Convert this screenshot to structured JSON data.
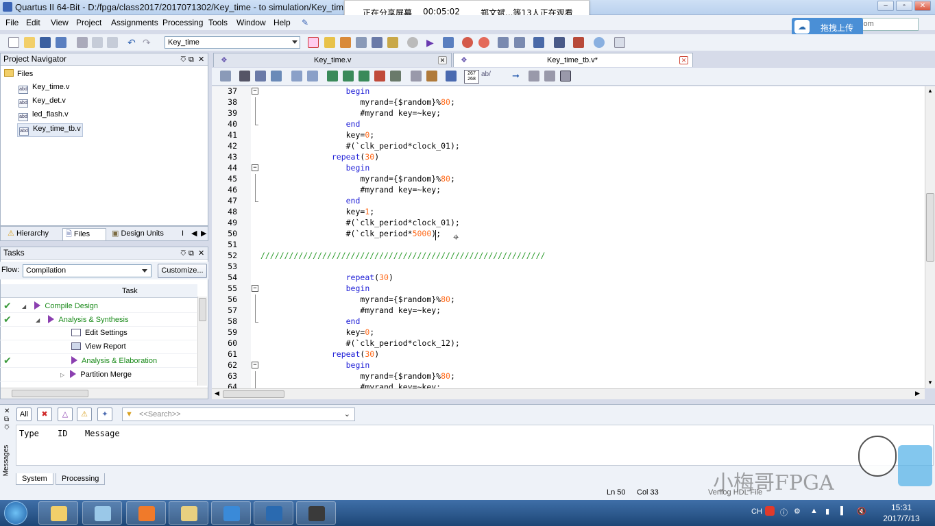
{
  "window": {
    "title": "Quartus II 64-Bit - D:/fpga/class2017/2017071302/Key_time - to simulation/Key_tim",
    "controls": {
      "minimize": "–",
      "restore": "▫",
      "close": "✕"
    }
  },
  "share_banner": {
    "status": "正在分享屏幕",
    "elapsed": "00:05:02",
    "viewers": "郑文斌...等13人正在观看"
  },
  "menu": {
    "items": [
      "File",
      "Edit",
      "View",
      "Project",
      "Assignments",
      "Processing",
      "Tools",
      "Window",
      "Help"
    ]
  },
  "upload_badge": {
    "label": "拖拽上传"
  },
  "top_search": {
    "value": "era.com"
  },
  "toolbar": {
    "entity": "Key_time"
  },
  "project_navigator": {
    "title": "Project Navigator",
    "root": "Files",
    "files": [
      "Key_time.v",
      "Key_det.v",
      "led_flash.v",
      "Key_time_tb.v"
    ],
    "selected": "Key_time_tb.v",
    "tabs": [
      "Hierarchy",
      "Files",
      "Design Units",
      "I"
    ],
    "active_tab": "Files"
  },
  "tasks": {
    "title": "Tasks",
    "flow_label": "Flow:",
    "flow_value": "Compilation",
    "customize_label": "Customize...",
    "column_header": "Task",
    "rows": [
      {
        "label": "Compile Design",
        "done": true,
        "indent": 1,
        "color": "green"
      },
      {
        "label": "Analysis & Synthesis",
        "done": true,
        "indent": 2,
        "color": "green"
      },
      {
        "label": "Edit Settings",
        "done": false,
        "indent": 3,
        "color": "black"
      },
      {
        "label": "View Report",
        "done": false,
        "indent": 3,
        "color": "black"
      },
      {
        "label": "Analysis & Elaboration",
        "done": true,
        "indent": 3,
        "color": "green"
      },
      {
        "label": "Partition Merge",
        "done": false,
        "indent": 3,
        "color": "black"
      }
    ]
  },
  "documents": {
    "tabs": [
      {
        "label": "Key_time.v",
        "active": false
      },
      {
        "label": "Key_time_tb.v*",
        "active": true
      }
    ]
  },
  "editor": {
    "zoom_badge": "267\n268",
    "lines": [
      {
        "num": "37",
        "fold": "box",
        "segments": [
          [
            "",
            "                  "
          ],
          [
            "kw",
            "begin"
          ]
        ]
      },
      {
        "num": "38",
        "fold": "line",
        "segments": [
          [
            "",
            "                     myrand={$random}%"
          ],
          [
            "num",
            "80"
          ],
          [
            "",
            ";"
          ]
        ]
      },
      {
        "num": "39",
        "fold": "line",
        "segments": [
          [
            "",
            "                     #myrand key=~key;"
          ]
        ]
      },
      {
        "num": "40",
        "fold": "end",
        "segments": [
          [
            "",
            "                  "
          ],
          [
            "kw",
            "end"
          ]
        ]
      },
      {
        "num": "41",
        "fold": "none",
        "segments": [
          [
            "",
            "                  key="
          ],
          [
            "num",
            "0"
          ],
          [
            "",
            ";"
          ]
        ]
      },
      {
        "num": "42",
        "fold": "none",
        "segments": [
          [
            "",
            "                  #(`clk_period*clock_01);"
          ]
        ]
      },
      {
        "num": "43",
        "fold": "none",
        "segments": [
          [
            "",
            "               "
          ],
          [
            "kw",
            "repeat"
          ],
          [
            "",
            "("
          ],
          [
            "num",
            "30"
          ],
          [
            "",
            ")"
          ]
        ]
      },
      {
        "num": "44",
        "fold": "box",
        "segments": [
          [
            "",
            "                  "
          ],
          [
            "kw",
            "begin"
          ]
        ]
      },
      {
        "num": "45",
        "fold": "line",
        "segments": [
          [
            "",
            "                     myrand={$random}%"
          ],
          [
            "num",
            "80"
          ],
          [
            "",
            ";"
          ]
        ]
      },
      {
        "num": "46",
        "fold": "line",
        "segments": [
          [
            "",
            "                     #myrand key=~key;"
          ]
        ]
      },
      {
        "num": "47",
        "fold": "end",
        "segments": [
          [
            "",
            "                  "
          ],
          [
            "kw",
            "end"
          ]
        ]
      },
      {
        "num": "48",
        "fold": "none",
        "segments": [
          [
            "",
            "                  key="
          ],
          [
            "num",
            "1"
          ],
          [
            "",
            ";"
          ]
        ]
      },
      {
        "num": "49",
        "fold": "none",
        "segments": [
          [
            "",
            "                  #(`clk_period*clock_01);"
          ]
        ]
      },
      {
        "num": "50",
        "fold": "none",
        "segments": [
          [
            "",
            "                  #(`clk_period*"
          ],
          [
            "num",
            "5000"
          ],
          [
            "",
            ");"
          ]
        ]
      },
      {
        "num": "51",
        "fold": "none",
        "segments": [
          [
            "",
            ""
          ]
        ]
      },
      {
        "num": "52",
        "fold": "none",
        "segments": [
          [
            "cmt",
            "////////////////////////////////////////////////////////////"
          ]
        ]
      },
      {
        "num": "53",
        "fold": "none",
        "segments": [
          [
            "",
            ""
          ]
        ]
      },
      {
        "num": "54",
        "fold": "none",
        "segments": [
          [
            "",
            "                  "
          ],
          [
            "kw",
            "repeat"
          ],
          [
            "",
            "("
          ],
          [
            "num",
            "30"
          ],
          [
            "",
            ")"
          ]
        ]
      },
      {
        "num": "55",
        "fold": "box",
        "segments": [
          [
            "",
            "                  "
          ],
          [
            "kw",
            "begin"
          ]
        ]
      },
      {
        "num": "56",
        "fold": "line",
        "segments": [
          [
            "",
            "                     myrand={$random}%"
          ],
          [
            "num",
            "80"
          ],
          [
            "",
            ";"
          ]
        ]
      },
      {
        "num": "57",
        "fold": "line",
        "segments": [
          [
            "",
            "                     #myrand key=~key;"
          ]
        ]
      },
      {
        "num": "58",
        "fold": "end",
        "segments": [
          [
            "",
            "                  "
          ],
          [
            "kw",
            "end"
          ]
        ]
      },
      {
        "num": "59",
        "fold": "none",
        "segments": [
          [
            "",
            "                  key="
          ],
          [
            "num",
            "0"
          ],
          [
            "",
            ";"
          ]
        ]
      },
      {
        "num": "60",
        "fold": "none",
        "segments": [
          [
            "",
            "                  #(`clk_period*clock_12);"
          ]
        ]
      },
      {
        "num": "61",
        "fold": "none",
        "segments": [
          [
            "",
            "               "
          ],
          [
            "kw",
            "repeat"
          ],
          [
            "",
            "("
          ],
          [
            "num",
            "30"
          ],
          [
            "",
            ")"
          ]
        ]
      },
      {
        "num": "62",
        "fold": "box",
        "segments": [
          [
            "",
            "                  "
          ],
          [
            "kw",
            "begin"
          ]
        ]
      },
      {
        "num": "63",
        "fold": "line",
        "segments": [
          [
            "",
            "                     myrand={$random}%"
          ],
          [
            "num",
            "80"
          ],
          [
            "",
            ";"
          ]
        ]
      },
      {
        "num": "64",
        "fold": "line",
        "segments": [
          [
            "",
            "                     #myrand key=~key;"
          ]
        ]
      }
    ]
  },
  "messages": {
    "side_label": "Messages",
    "filter_all": "All",
    "search_placeholder": "<<Search>>",
    "columns": [
      "Type",
      "ID",
      "Message"
    ],
    "tabs": [
      "System",
      "Processing"
    ]
  },
  "status": {
    "line": "Ln 50",
    "col": "Col 33",
    "file_type": "Verilog HDL File"
  },
  "watermark": "小梅哥FPGA",
  "taskbar": {
    "tray_lang": "CH",
    "time": "15:31",
    "date": "2017/7/13"
  },
  "colors": {
    "keyword": "#1c1cd6",
    "number": "#ff6a1a",
    "comment": "#2a9a2a",
    "task_done": "#1a8a1a"
  }
}
